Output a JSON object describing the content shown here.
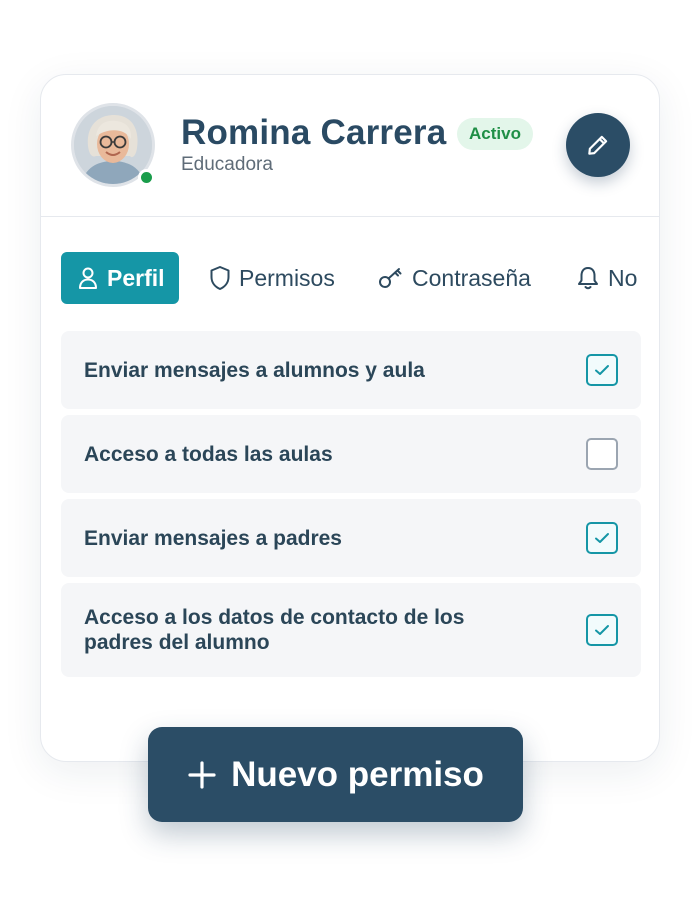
{
  "profile": {
    "name": "Romina Carrera",
    "status": "Activo",
    "role": "Educadora",
    "online": true
  },
  "icons": {
    "edit": "pencil-icon",
    "profile_tab": "user-icon",
    "permissions_tab": "shield-icon",
    "password_tab": "key-icon",
    "notifications_tab": "bell-icon",
    "add": "plus-icon"
  },
  "tabs": [
    {
      "label": "Perfil",
      "active": true
    },
    {
      "label": "Permisos",
      "active": false
    },
    {
      "label": "Contraseña",
      "active": false
    },
    {
      "label": "No",
      "active": false
    }
  ],
  "permissions": [
    {
      "label": "Enviar mensajes a alumnos y aula",
      "checked": true
    },
    {
      "label": "Acceso a todas las aulas",
      "checked": false
    },
    {
      "label": "Enviar mensajes a padres",
      "checked": true
    },
    {
      "label": "Acceso a los datos de contacto de los padres del alumno",
      "checked": true
    }
  ],
  "actions": {
    "new_permission_label": "Nuevo permiso"
  },
  "colors": {
    "primary_dark": "#2b4d66",
    "accent_teal": "#1596a6",
    "status_green": "#1f8f46",
    "online_green": "#1a9d4b"
  }
}
